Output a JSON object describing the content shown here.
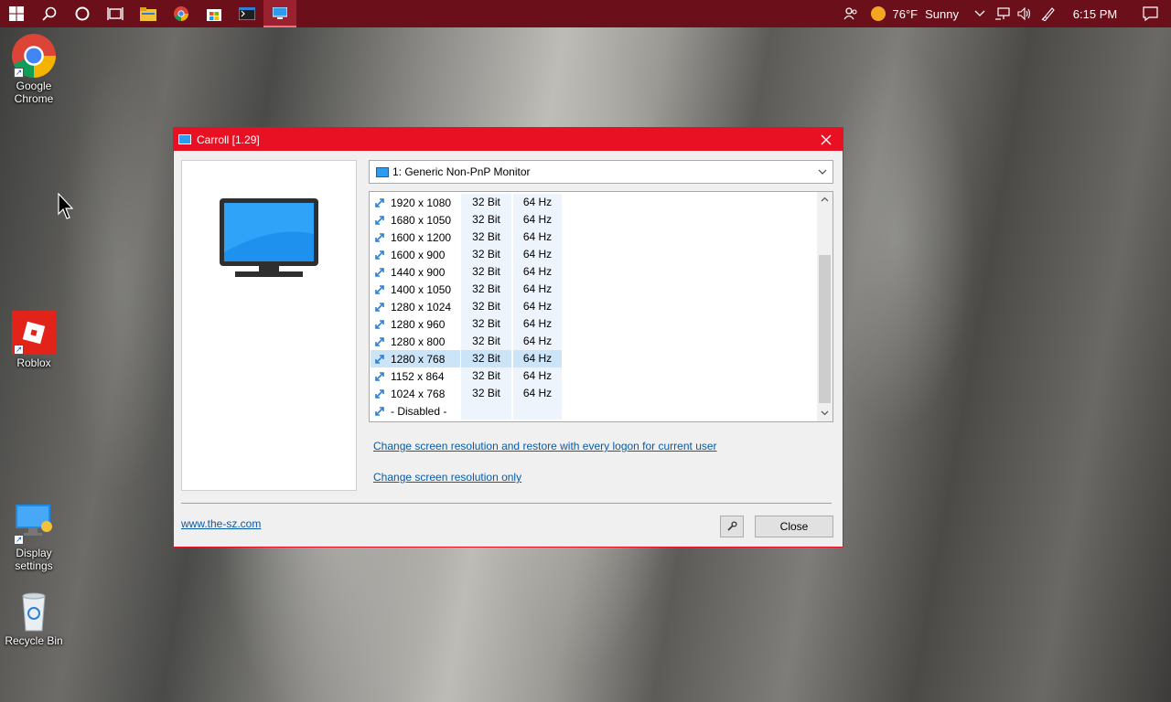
{
  "taskbar": {
    "weather_temp": "76°F",
    "weather_cond": "Sunny",
    "time": "6:15 PM",
    "color": "#6b0f1a"
  },
  "desktop": {
    "icons": [
      {
        "label_line1": "Google",
        "label_line2": "Chrome"
      },
      {
        "label_line1": "Roblox",
        "label_line2": ""
      },
      {
        "label_line1": "Display",
        "label_line2": "settings"
      },
      {
        "label_line1": "Recycle Bin",
        "label_line2": ""
      }
    ]
  },
  "window": {
    "title": "Carroll [1.29]",
    "accent": "#e81123",
    "monitor_select": "1: Generic Non-PnP Monitor",
    "resolutions": [
      {
        "res": "1920 x 1080",
        "bits": "32 Bit",
        "hz": "64 Hz",
        "selected": false
      },
      {
        "res": "1680 x 1050",
        "bits": "32 Bit",
        "hz": "64 Hz",
        "selected": false
      },
      {
        "res": "1600 x 1200",
        "bits": "32 Bit",
        "hz": "64 Hz",
        "selected": false
      },
      {
        "res": "1600 x 900",
        "bits": "32 Bit",
        "hz": "64 Hz",
        "selected": false
      },
      {
        "res": "1440 x 900",
        "bits": "32 Bit",
        "hz": "64 Hz",
        "selected": false
      },
      {
        "res": "1400 x 1050",
        "bits": "32 Bit",
        "hz": "64 Hz",
        "selected": false
      },
      {
        "res": "1280 x 1024",
        "bits": "32 Bit",
        "hz": "64 Hz",
        "selected": false
      },
      {
        "res": "1280 x 960",
        "bits": "32 Bit",
        "hz": "64 Hz",
        "selected": false
      },
      {
        "res": "1280 x 800",
        "bits": "32 Bit",
        "hz": "64 Hz",
        "selected": false
      },
      {
        "res": "1280 x 768",
        "bits": "32 Bit",
        "hz": "64 Hz",
        "selected": true
      },
      {
        "res": "1152 x 864",
        "bits": "32 Bit",
        "hz": "64 Hz",
        "selected": false
      },
      {
        "res": "1024 x 768",
        "bits": "32 Bit",
        "hz": "64 Hz",
        "selected": false
      },
      {
        "res": "- Disabled -",
        "bits": "",
        "hz": "",
        "selected": false
      }
    ],
    "link_restore": "Change screen resolution and restore with every logon for current user",
    "link_only": "Change screen resolution only",
    "website": "www.the-sz.com",
    "close_label": "Close"
  }
}
